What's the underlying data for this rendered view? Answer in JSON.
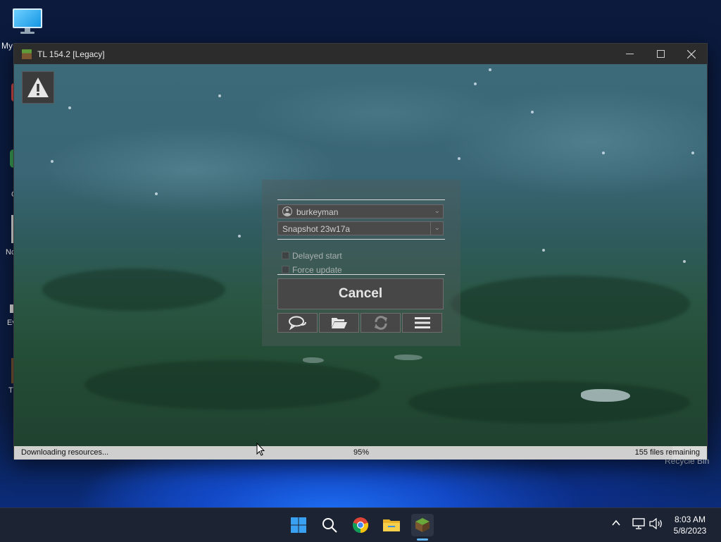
{
  "desktop": {
    "icon_label": "My",
    "recycle_bin_label": "Recycle Bin",
    "edge_labels": [
      "C",
      "Nc",
      "Ev",
      "T"
    ]
  },
  "window": {
    "title": "TL 154.2 [Legacy]",
    "controls": {
      "minimize": "minimize-icon",
      "maximize": "maximize-icon",
      "close": "close-icon"
    }
  },
  "launcher": {
    "account": "burkeyman",
    "version": "Snapshot 23w17a",
    "options": [
      {
        "label": "Delayed start",
        "checked": false
      },
      {
        "label": "Force update",
        "checked": false
      }
    ],
    "cancel_label": "Cancel",
    "toolbar_icons": [
      "chat-icon",
      "folder-icon",
      "refresh-icon",
      "menu-icon"
    ]
  },
  "status": {
    "text": "Downloading resources...",
    "percent_label": "95%",
    "progress": 0.95,
    "remaining": "155 files remaining"
  },
  "taskbar": {
    "apps": [
      "start-icon",
      "search-icon",
      "chrome-icon",
      "file-explorer-icon",
      "tlauncher-icon"
    ],
    "time": "8:03 AM",
    "date": "5/8/2023"
  }
}
